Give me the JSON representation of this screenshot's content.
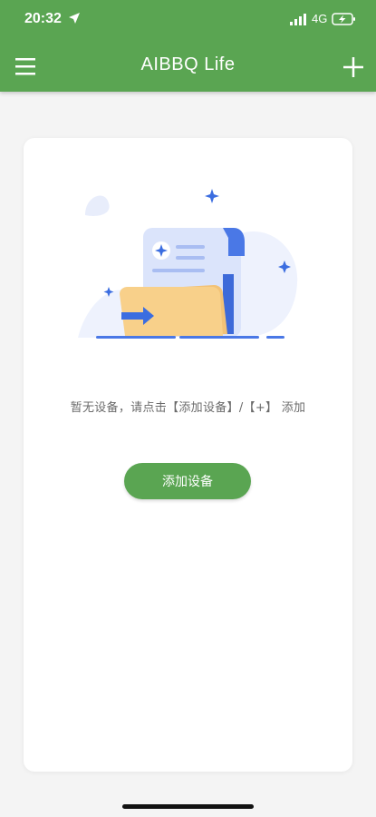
{
  "status_bar": {
    "time": "20:32",
    "network": "4G",
    "location_icon": "location-arrow-icon",
    "signal_icon": "signal-bars-icon",
    "battery_icon": "battery-charging-icon"
  },
  "header": {
    "title": "AIBBQ Life",
    "menu_icon": "hamburger-menu-icon",
    "add_icon": "plus-icon",
    "background": "#5aa552"
  },
  "empty_state": {
    "illustration": "empty-folder-document-illustration",
    "message": "暂无设备，请点击【添加设备】/【+】 添加",
    "button_label": "添加设备",
    "button_color": "#5aa552"
  }
}
